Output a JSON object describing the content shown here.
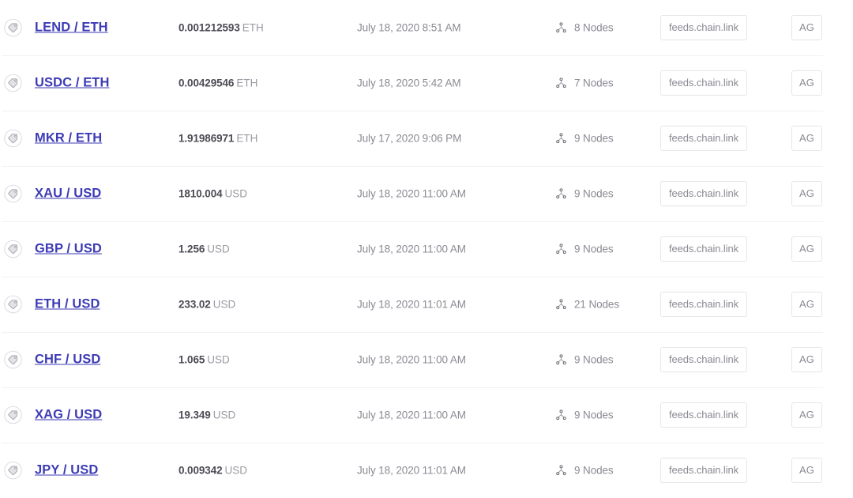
{
  "theme": {
    "link_color": "#3d3bb5",
    "value_color": "#4b4b54",
    "muted_color": "#8a8a93",
    "unit_color": "#9a9aa2",
    "separator_color": "#f1f1f3",
    "badge_border_color": "#e6e6e9",
    "background": "#ffffff"
  },
  "icons": {
    "tag": "tag-icon",
    "nodes": "nodes-network-icon"
  },
  "rows": [
    {
      "pair": "LEND / ETH",
      "amount": "0.001212593",
      "unit": "ETH",
      "timestamp": "July 18, 2020 8:51 AM",
      "nodes": "8 Nodes",
      "source": "feeds.chain.link",
      "org": "AG"
    },
    {
      "pair": "USDC / ETH",
      "amount": "0.00429546",
      "unit": "ETH",
      "timestamp": "July 18, 2020 5:42 AM",
      "nodes": "7 Nodes",
      "source": "feeds.chain.link",
      "org": "AG"
    },
    {
      "pair": "MKR / ETH",
      "amount": "1.91986971",
      "unit": "ETH",
      "timestamp": "July 17, 2020 9:06 PM",
      "nodes": "9 Nodes",
      "source": "feeds.chain.link",
      "org": "AG"
    },
    {
      "pair": "XAU / USD",
      "amount": "1810.004",
      "unit": "USD",
      "timestamp": "July 18, 2020 11:00 AM",
      "nodes": "9 Nodes",
      "source": "feeds.chain.link",
      "org": "AG"
    },
    {
      "pair": "GBP / USD",
      "amount": "1.256",
      "unit": "USD",
      "timestamp": "July 18, 2020 11:00 AM",
      "nodes": "9 Nodes",
      "source": "feeds.chain.link",
      "org": "AG"
    },
    {
      "pair": "ETH / USD",
      "amount": "233.02",
      "unit": "USD",
      "timestamp": "July 18, 2020 11:01 AM",
      "nodes": "21 Nodes",
      "source": "feeds.chain.link",
      "org": "AG"
    },
    {
      "pair": "CHF / USD",
      "amount": "1.065",
      "unit": "USD",
      "timestamp": "July 18, 2020 11:00 AM",
      "nodes": "9 Nodes",
      "source": "feeds.chain.link",
      "org": "AG"
    },
    {
      "pair": "XAG / USD",
      "amount": "19.349",
      "unit": "USD",
      "timestamp": "July 18, 2020 11:00 AM",
      "nodes": "9 Nodes",
      "source": "feeds.chain.link",
      "org": "AG"
    },
    {
      "pair": "JPY / USD",
      "amount": "0.009342",
      "unit": "USD",
      "timestamp": "July 18, 2020 11:01 AM",
      "nodes": "9 Nodes",
      "source": "feeds.chain.link",
      "org": "AG"
    }
  ]
}
